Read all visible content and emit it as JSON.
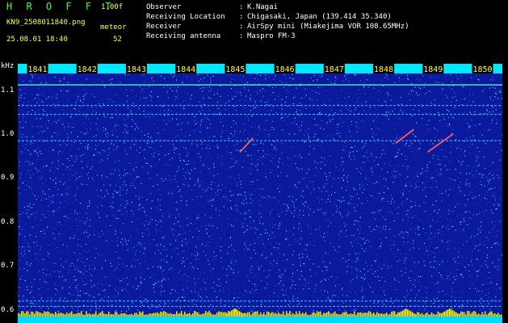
{
  "header": {
    "app_title": "H R O F F T",
    "version": "1.00f",
    "file_name": "KN9_2508011840.png",
    "meteor_label": "meteor",
    "timestamp": "25.08.01 18:40",
    "meteor_count": "52"
  },
  "station_info": [
    {
      "label": "Observer",
      "value": "K.Nagai"
    },
    {
      "label": "Receiving Location",
      "value": "Chigasaki, Japan (139.414 35.340)"
    },
    {
      "label": "Receiver",
      "value": "AirSpy mini (Miakejima VOR 108.65MHz)"
    },
    {
      "label": "Receiving antenna",
      "value": "Maspro FM-3"
    }
  ],
  "colors": {
    "background": "#000000",
    "spectrogram_base": "#0b1a9c",
    "title_green": "#3cff3c",
    "header_yellow": "#ffff40",
    "time_bar": "#00e8ff",
    "signal_cyan": "#40e0ff",
    "meteor_trail": "#ff6060",
    "bottom_yellow": "#ffff00"
  },
  "chart_data": {
    "type": "heatmap",
    "ylabel": "kHz",
    "ylim": [
      0.57,
      1.16
    ],
    "y_ticks": [
      "1.1",
      "1.0",
      "0.9",
      "0.8",
      "0.7",
      "0.6"
    ],
    "y_tick_values": [
      1.1,
      1.0,
      0.9,
      0.8,
      0.7,
      0.6
    ],
    "x_ticks": [
      "1841",
      "1842",
      "1843",
      "1844",
      "1845",
      "1846",
      "1847",
      "1848",
      "1849",
      "1850"
    ],
    "x_tick_values": [
      1841,
      1842,
      1843,
      1844,
      1845,
      1846,
      1847,
      1848,
      1849,
      1850
    ],
    "xlim": [
      1840.6,
      1850.4
    ],
    "carrier_lines_khz": [
      1.112,
      1.065,
      1.045,
      0.985,
      0.62,
      0.608
    ],
    "meteor_echoes": [
      {
        "t_start": 1845.1,
        "t_end": 1845.35,
        "f_start": 0.96,
        "f_end": 0.99
      },
      {
        "t_start": 1848.25,
        "t_end": 1848.6,
        "f_start": 0.98,
        "f_end": 1.01
      },
      {
        "t_start": 1848.9,
        "t_end": 1849.4,
        "f_start": 0.96,
        "f_end": 1.0
      }
    ]
  }
}
